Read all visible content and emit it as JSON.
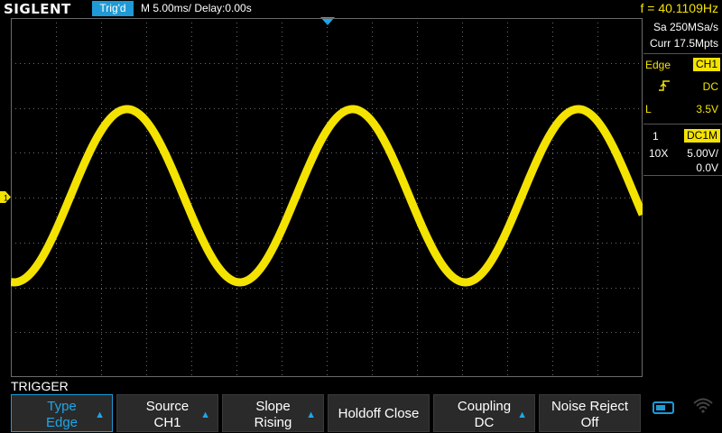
{
  "topbar": {
    "logo": "SIGLENT",
    "trigger_status": "Trig'd",
    "timebase": "M 5.00ms/ Delay:0.00s",
    "frequency": "f = 40.1109Hz"
  },
  "right_panel": {
    "sample_rate": "Sa 250MSa/s",
    "memory_depth": "Curr 17.5Mpts",
    "trigger_type": "Edge",
    "trigger_source": "CH1",
    "trigger_coupling": "DC",
    "trigger_level_label": "L",
    "trigger_level": "3.5V",
    "channel_number": "1",
    "channel_coupling": "DC1M",
    "probe": "10X",
    "volts_per_div": "5.00V/",
    "offset": "0.0V"
  },
  "markers": {
    "ch1_label": "1"
  },
  "menu": {
    "title": "TRIGGER",
    "softkeys": [
      {
        "line1": "Type",
        "line2": "Edge",
        "active": true
      },
      {
        "line1": "Source",
        "line2": "CH1"
      },
      {
        "line1": "Slope",
        "line2": "Rising"
      },
      {
        "line1": "Holdoff Close"
      },
      {
        "line1": "Coupling",
        "line2": "DC"
      },
      {
        "line1": "Noise Reject",
        "line2": "Off"
      }
    ]
  },
  "waveform": {
    "color": "#f4e300",
    "cycles_visible": 2.8
  },
  "colors": {
    "accent_blue": "#1f9ad6",
    "channel_yellow": "#f4e300",
    "grid": "#6a6a6a"
  }
}
